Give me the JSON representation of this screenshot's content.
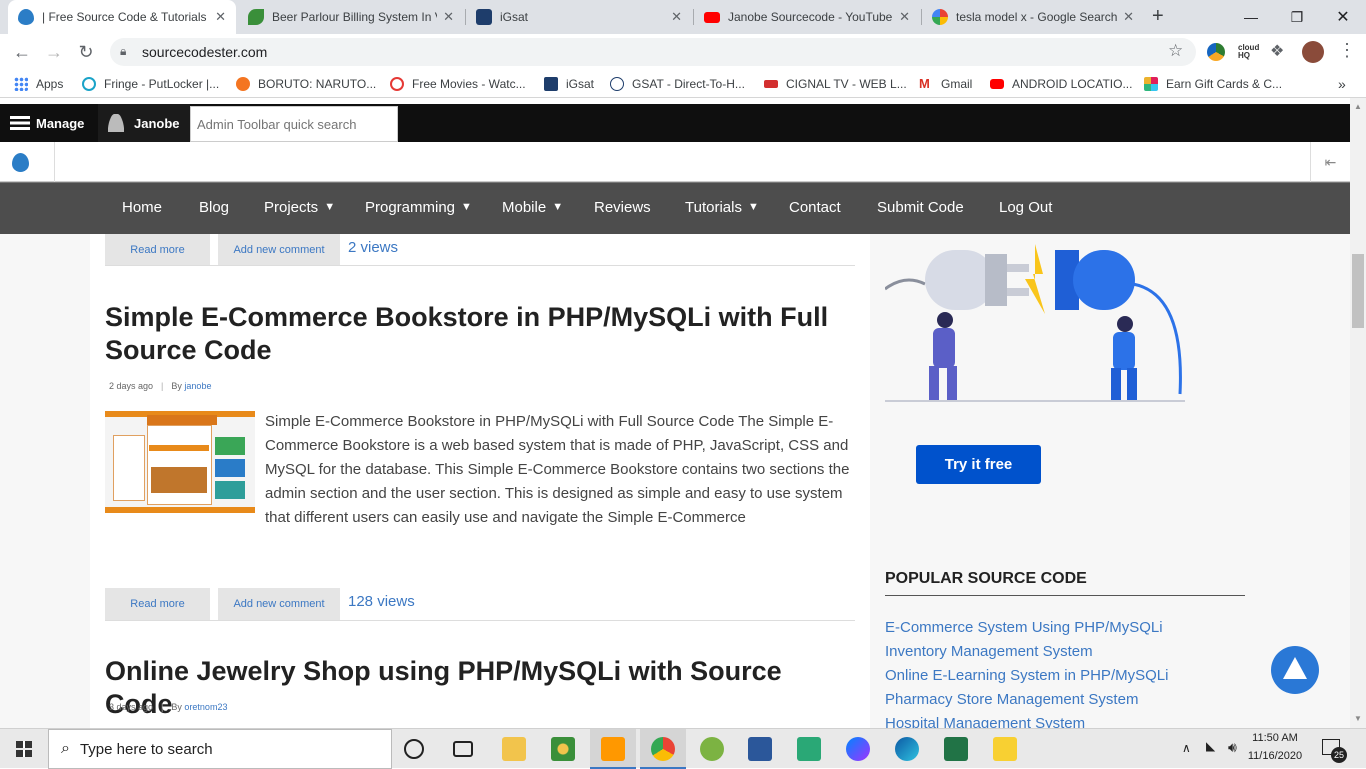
{
  "browser": {
    "tabs": [
      {
        "title": "| Free Source Code & Tutorials",
        "favicon": "drupal-icon",
        "active": true
      },
      {
        "title": "Beer Parlour Billing System In V",
        "favicon": "leaf-icon"
      },
      {
        "title": "iGsat",
        "favicon": "igsat-icon"
      },
      {
        "title": "Janobe Sourcecode - YouTube",
        "favicon": "youtube-icon"
      },
      {
        "title": "tesla model x - Google Search",
        "favicon": "google-icon"
      }
    ],
    "new_tab": "+",
    "url": "sourcecodester.com",
    "bookmarks": [
      {
        "label": "Apps",
        "icon": "apps-grid-icon"
      },
      {
        "label": "Fringe - PutLocker |...",
        "icon": "play-circle-icon"
      },
      {
        "label": "BORUTO: NARUTO...",
        "icon": "crunchyroll-icon"
      },
      {
        "label": "Free Movies - Watc...",
        "icon": "play-circle-icon"
      },
      {
        "label": "iGsat",
        "icon": "igsat-icon"
      },
      {
        "label": "GSAT - Direct-To-H...",
        "icon": "gsat-icon"
      },
      {
        "label": "CIGNAL TV - WEB L...",
        "icon": "cignal-icon"
      },
      {
        "label": "Gmail",
        "icon": "gmail-icon"
      },
      {
        "label": "ANDROID LOCATIO...",
        "icon": "youtube-icon"
      },
      {
        "label": "Earn Gift Cards & C...",
        "icon": "slack-icon"
      }
    ],
    "more_bookmarks": "»"
  },
  "admin": {
    "manage": "Manage",
    "user": "Janobe",
    "search_placeholder": "Admin Toolbar quick search"
  },
  "nav": [
    {
      "label": "Home",
      "dropdown": false
    },
    {
      "label": "Blog",
      "dropdown": false
    },
    {
      "label": "Projects",
      "dropdown": true
    },
    {
      "label": "Programming",
      "dropdown": true
    },
    {
      "label": "Mobile",
      "dropdown": true
    },
    {
      "label": "Reviews",
      "dropdown": false
    },
    {
      "label": "Tutorials",
      "dropdown": true
    },
    {
      "label": "Contact",
      "dropdown": false
    },
    {
      "label": "Submit Code",
      "dropdown": false
    },
    {
      "label": "Log Out",
      "dropdown": false
    }
  ],
  "posts": [
    {
      "read_more": "Read more",
      "add_comment": "Add new comment",
      "views": "2 views"
    },
    {
      "title": "Simple E-Commerce Bookstore in PHP/MySQLi with Full Source Code",
      "date": "2 days ago",
      "by": "By",
      "author": "janobe",
      "excerpt": "Simple E-Commerce Bookstore in PHP/MySQLi with Full Source Code The Simple E-Commerce Bookstore is a web based system that is made of PHP, JavaScript, CSS and MySQL for the database. This Simple E-Commerce Bookstore contains two sections the admin section and the user section. This is designed as simple and easy to use system that different users can easily use and navigate the Simple E-Commerce",
      "read_more": "Read more",
      "add_comment": "Add new comment",
      "views": "128 views"
    },
    {
      "title": "Online Jewelry Shop using PHP/MySQLi with Source Code",
      "date": "3 days ago",
      "by": "By",
      "author": "oretnom23"
    }
  ],
  "sidebar": {
    "cta": "Try it free",
    "popular_heading": "POPULAR SOURCE CODE",
    "popular": [
      "E-Commerce System Using PHP/MySQLi",
      "Inventory Management System",
      "Online E-Learning System in PHP/MySQLi",
      "Pharmacy Store Management System",
      "Hospital Management System"
    ]
  },
  "taskbar": {
    "search_placeholder": "Type here to search",
    "time": "11:50 AM",
    "date": "11/16/2020",
    "notifications": "25"
  },
  "colors": {
    "link": "#3c78c3",
    "nav_bg": "#4d4d4d",
    "cta": "#0052cc",
    "scroll_top": "#2a78d6"
  }
}
